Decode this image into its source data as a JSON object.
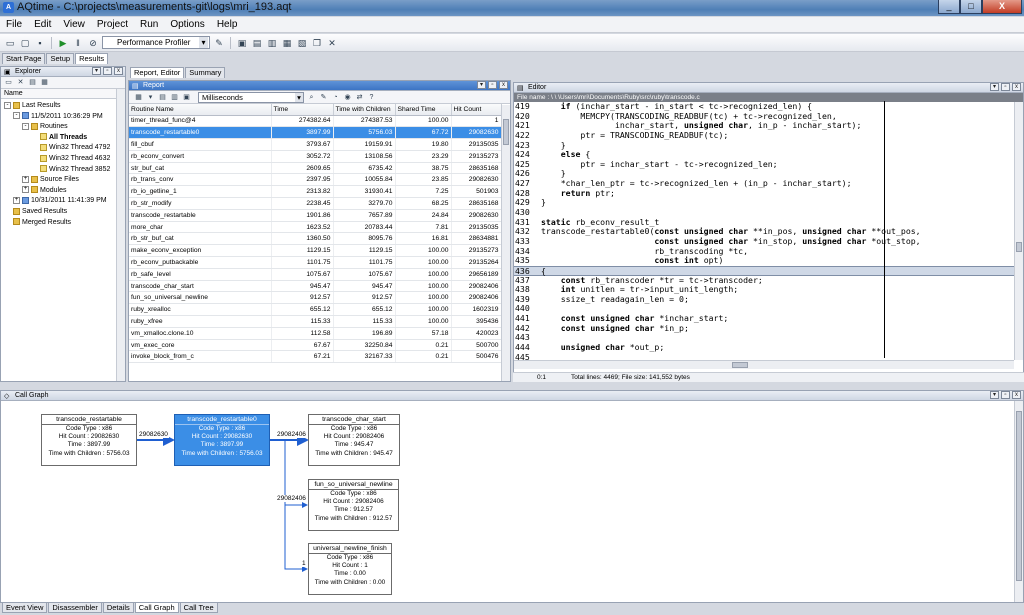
{
  "window": {
    "title": "AQtime - C:\\projects\\measurements-git\\logs\\mri_193.aqt",
    "controls": [
      "_",
      "□",
      "X"
    ]
  },
  "menu": [
    "File",
    "Edit",
    "View",
    "Project",
    "Run",
    "Options",
    "Help"
  ],
  "toolbar": {
    "profiler": "Performance Profiler"
  },
  "main_tabs": [
    "Start Page",
    "Setup",
    "Results"
  ],
  "explorer": {
    "title": "Explorer",
    "column": "Name",
    "tree": [
      {
        "label": "Last Results",
        "level": 0,
        "exp": "-",
        "icon": "folder"
      },
      {
        "label": "11/5/2011 10:36:29 PM",
        "level": 1,
        "exp": "-",
        "icon": "result"
      },
      {
        "label": "Routines",
        "level": 2,
        "exp": "-",
        "icon": "folder"
      },
      {
        "label": "All Threads",
        "level": 3,
        "exp": "",
        "icon": "thread",
        "bold": true
      },
      {
        "label": "Win32 Thread 4792",
        "level": 3,
        "exp": "",
        "icon": "thread"
      },
      {
        "label": "Win32 Thread 4632",
        "level": 3,
        "exp": "",
        "icon": "thread"
      },
      {
        "label": "Win32 Thread 3852",
        "level": 3,
        "exp": "",
        "icon": "thread"
      },
      {
        "label": "Source Files",
        "level": 2,
        "exp": "+",
        "icon": "folder"
      },
      {
        "label": "Modules",
        "level": 2,
        "exp": "+",
        "icon": "folder"
      },
      {
        "label": "10/31/2011 11:41:39 PM",
        "level": 1,
        "exp": "+",
        "icon": "result"
      },
      {
        "label": "Saved Results",
        "level": 0,
        "exp": "",
        "icon": "folder"
      },
      {
        "label": "Merged Results",
        "level": 0,
        "exp": "",
        "icon": "folder"
      }
    ]
  },
  "report": {
    "tabs": [
      "Report, Editor",
      "Summary"
    ],
    "title": "Report",
    "units": "Milliseconds",
    "columns": [
      "Routine Name",
      "Time",
      "Time with Children",
      "Shared Time",
      "Hit Count"
    ],
    "rows": [
      [
        "timer_thread_func@4",
        "274382.64",
        "274387.53",
        "100.00",
        "1"
      ],
      [
        "transcode_restartable0",
        "3897.99",
        "5756.03",
        "67.72",
        "29082630"
      ],
      [
        "fill_cbuf",
        "3793.67",
        "19159.91",
        "19.80",
        "29135035"
      ],
      [
        "rb_econv_convert",
        "3052.72",
        "13108.56",
        "23.29",
        "29135273"
      ],
      [
        "str_buf_cat",
        "2609.65",
        "6735.42",
        "38.75",
        "28635168"
      ],
      [
        "rb_trans_conv",
        "2397.95",
        "10055.84",
        "23.85",
        "29082630"
      ],
      [
        "rb_io_getline_1",
        "2313.82",
        "31930.41",
        "7.25",
        "501903"
      ],
      [
        "rb_str_modify",
        "2238.45",
        "3279.70",
        "68.25",
        "28635168"
      ],
      [
        "transcode_restartable",
        "1901.86",
        "7657.89",
        "24.84",
        "29082630"
      ],
      [
        "more_char",
        "1623.52",
        "20783.44",
        "7.81",
        "29135035"
      ],
      [
        "rb_str_buf_cat",
        "1360.50",
        "8095.76",
        "16.81",
        "28634881"
      ],
      [
        "make_econv_exception",
        "1129.15",
        "1129.15",
        "100.00",
        "29135273"
      ],
      [
        "rb_econv_putbackable",
        "1101.75",
        "1101.75",
        "100.00",
        "29135264"
      ],
      [
        "rb_safe_level",
        "1075.67",
        "1075.67",
        "100.00",
        "29656189"
      ],
      [
        "transcode_char_start",
        "945.47",
        "945.47",
        "100.00",
        "29082406"
      ],
      [
        "fun_so_universal_newline",
        "912.57",
        "912.57",
        "100.00",
        "29082406"
      ],
      [
        "ruby_xrealloc",
        "655.12",
        "655.12",
        "100.00",
        "1602319"
      ],
      [
        "ruby_xfree",
        "115.33",
        "115.33",
        "100.00",
        "395436"
      ],
      [
        "vm_xmalloc.clone.10",
        "112.58",
        "196.89",
        "57.18",
        "420023"
      ],
      [
        "vm_exec_core",
        "67.67",
        "32250.84",
        "0.21",
        "500700"
      ],
      [
        "invoke_block_from_c",
        "67.21",
        "32167.33",
        "0.21",
        "500476"
      ]
    ]
  },
  "editor": {
    "title": "Editor",
    "file_name": "File name : \\ \\ \\Users\\mri\\Documents\\Ruby\\src\\ruby\\transcode.c",
    "lines": [
      {
        "n": "419",
        "t": "    if (inchar_start - in_start < tc->recognized_len) {"
      },
      {
        "n": "420",
        "t": "        MEMCPY(TRANSCODING_READBUF(tc) + tc->recognized_len,"
      },
      {
        "n": "421",
        "t": "               inchar_start, unsigned char, in_p - inchar_start);"
      },
      {
        "n": "422",
        "t": "        ptr = TRANSCODING_READBUF(tc);"
      },
      {
        "n": "423",
        "t": "    }"
      },
      {
        "n": "424",
        "t": "    else {"
      },
      {
        "n": "425",
        "t": "        ptr = inchar_start - tc->recognized_len;"
      },
      {
        "n": "426",
        "t": "    }"
      },
      {
        "n": "427",
        "t": "    *char_len_ptr = tc->recognized_len + (in_p - inchar_start);"
      },
      {
        "n": "428",
        "t": "    return ptr;"
      },
      {
        "n": "429",
        "t": "}"
      },
      {
        "n": "430",
        "t": ""
      },
      {
        "n": "431",
        "t": "static rb_econv_result_t"
      },
      {
        "n": "432",
        "t": "transcode_restartable0(const unsigned char **in_pos, unsigned char **out_pos,"
      },
      {
        "n": "433",
        "t": "                       const unsigned char *in_stop, unsigned char *out_stop,"
      },
      {
        "n": "434",
        "t": "                       rb_transcoding *tc,"
      },
      {
        "n": "435",
        "t": "                       const int opt)"
      },
      {
        "n": "436",
        "t": "{"
      },
      {
        "n": "437",
        "t": "    const rb_transcoder *tr = tc->transcoder;"
      },
      {
        "n": "438",
        "t": "    int unitlen = tr->input_unit_length;"
      },
      {
        "n": "439",
        "t": "    ssize_t readagain_len = 0;"
      },
      {
        "n": "440",
        "t": ""
      },
      {
        "n": "441",
        "t": "    const unsigned char *inchar_start;"
      },
      {
        "n": "442",
        "t": "    const unsigned char *in_p;"
      },
      {
        "n": "443",
        "t": ""
      },
      {
        "n": "444",
        "t": "    unsigned char *out_p;"
      },
      {
        "n": "445",
        "t": ""
      }
    ],
    "current_line": "436",
    "status_pos": "0:1",
    "status_info": "Total lines: 4469; File size: 141,552 bytes"
  },
  "callgraph": {
    "title": "Call Graph",
    "nodes": [
      {
        "name": "transcode_restartable",
        "code_type": "Code Type : x86",
        "hit": "Hit Count : 29082630",
        "time": "Time : 3897.99",
        "twc": "Time with Children : 5756.03"
      },
      {
        "name": "transcode_restartable0",
        "code_type": "Code Type : x86",
        "hit": "Hit Count : 29082630",
        "time": "Time : 3897.99",
        "twc": "Time with Children : 5756.03"
      },
      {
        "name": "transcode_char_start",
        "code_type": "Code Type : x86",
        "hit": "Hit Count : 29082406",
        "time": "Time : 945.47",
        "twc": "Time with Children : 945.47"
      },
      {
        "name": "fun_so_universal_newline",
        "code_type": "Code Type : x86",
        "hit": "Hit Count : 29082406",
        "time": "Time : 912.57",
        "twc": "Time with Children : 912.57"
      },
      {
        "name": "universal_newline_finish",
        "code_type": "Code Type : x86",
        "hit": "Hit Count : 1",
        "time": "Time : 0.00",
        "twc": "Time with Children : 0.00"
      }
    ],
    "edges": [
      "29082630",
      "29082406",
      "29082406",
      "1"
    ]
  },
  "bottom_tabs": [
    "Event View",
    "Disassembler",
    "Details",
    "Call Graph",
    "Call Tree"
  ],
  "colors": {
    "selection": "#3b8ee6",
    "title_bar": "#4f7fb6"
  }
}
